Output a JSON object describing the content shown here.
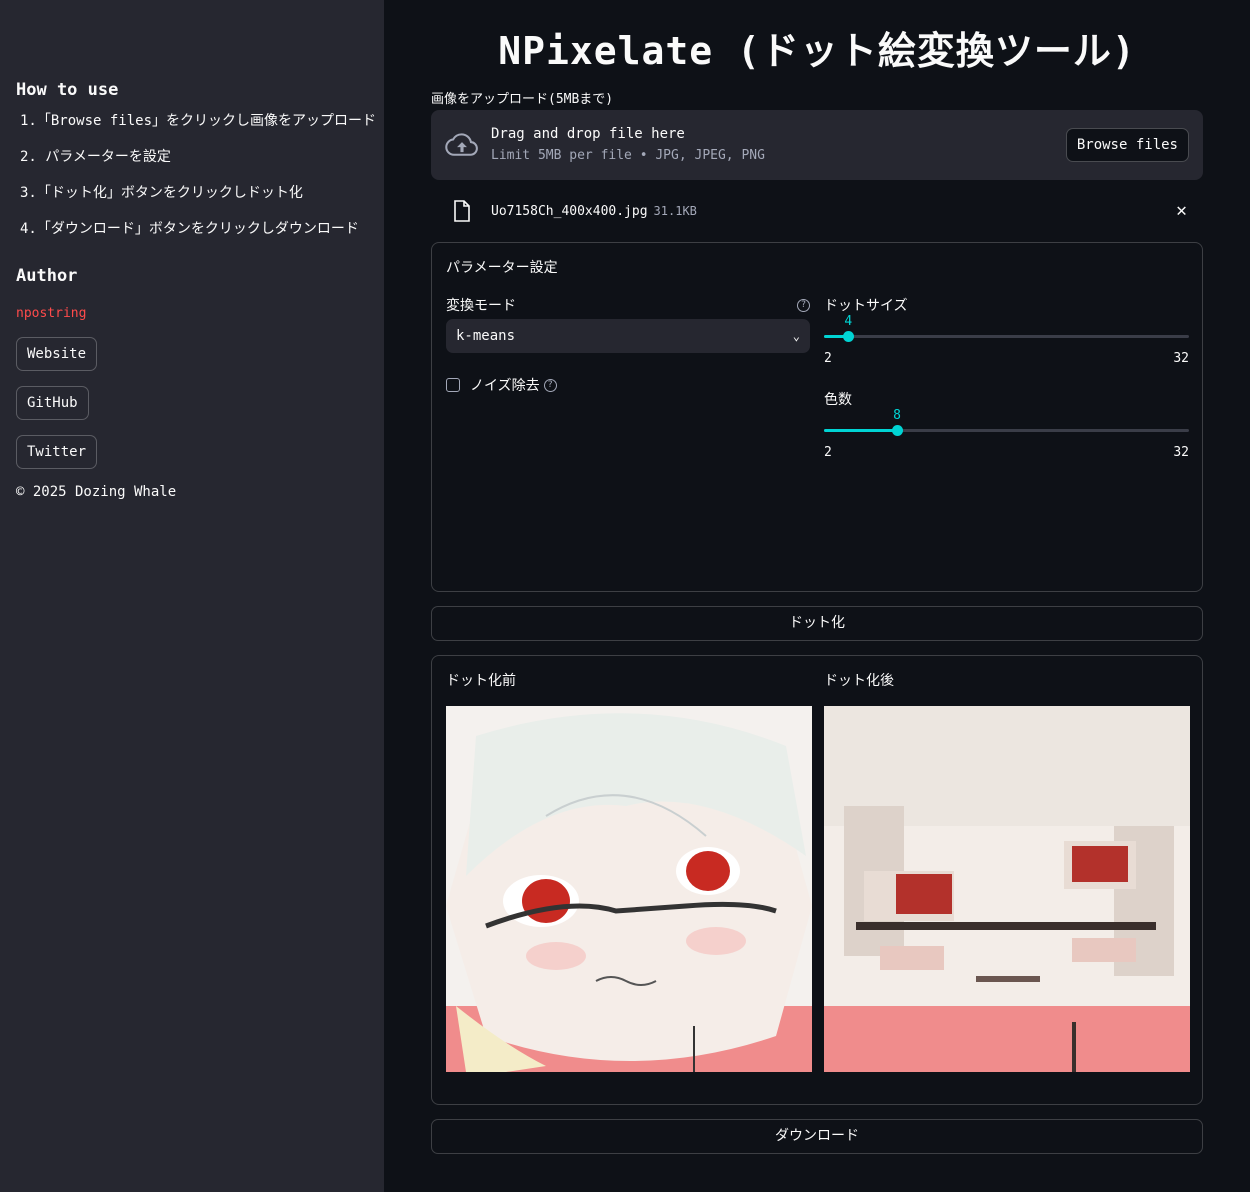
{
  "sidebar": {
    "how_to_heading": "How to use",
    "steps": [
      "1.「Browse files」をクリックし画像をアップロード",
      "2. パラメーターを設定",
      "3.「ドット化」ボタンをクリックしドット化",
      "4.「ダウンロード」ボタンをクリックしダウンロード"
    ],
    "author_heading": "Author",
    "author_name": "npostring",
    "links": [
      "Website",
      "GitHub",
      "Twitter"
    ],
    "copyright": "© 2025 Dozing Whale"
  },
  "main": {
    "title": "NPixelate (ドット絵変換ツール)",
    "upload": {
      "label": "画像をアップロード(5MBまで)",
      "drop_text": "Drag and drop file here",
      "limit_text": "Limit 5MB per file • JPG, JPEG, PNG",
      "browse_label": "Browse files",
      "file_name": "Uo7158Ch_400x400.jpg",
      "file_size": "31.1KB"
    },
    "params": {
      "title": "パラメーター設定",
      "mode_label": "変換モード",
      "mode_value": "k-means",
      "denoise_label": "ノイズ除去",
      "denoise_checked": false,
      "dot_size": {
        "label": "ドットサイズ",
        "value": "4",
        "min": "2",
        "max": "32"
      },
      "colors": {
        "label": "色数",
        "value": "8",
        "min": "2",
        "max": "32"
      }
    },
    "convert_button": "ドット化",
    "before_label": "ドット化前",
    "after_label": "ドット化後",
    "download_button": "ダウンロード"
  },
  "colors": {
    "accent": "#00d4d4",
    "author_link": "#ff4b4b",
    "background": "#0e1117",
    "sidebar": "#262730"
  }
}
